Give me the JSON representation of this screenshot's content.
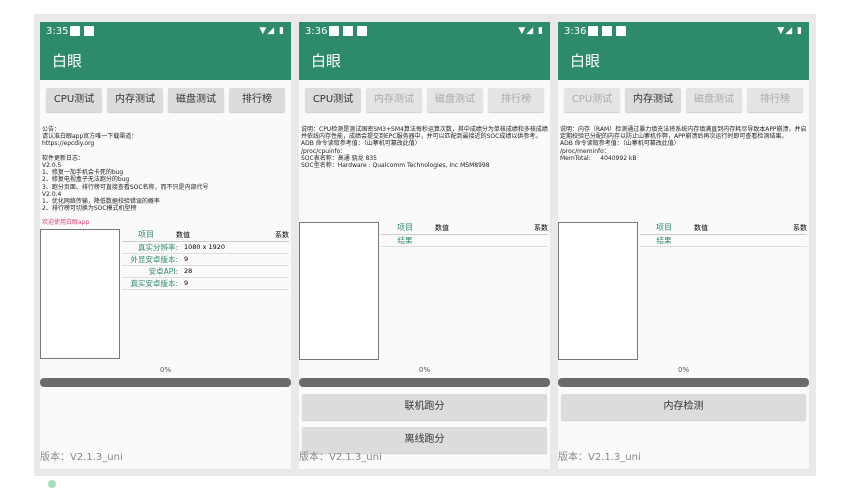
{
  "screens": [
    {
      "time": "3:35",
      "app_title": "白眼",
      "tabs": [
        "CPU测试",
        "内存测试",
        "磁盘测试",
        "排行榜"
      ],
      "notice": "公告：\n请认准白眼app官方唯一下载渠道：\nhttps://epcdiy.org\n\n软件更新日志：\nV2.0.5\n1、修复一加手机会卡死的bug\n2、修复电视盒子无法跑分的bug\n3、跑分页面、排行榜可直接查看SOC名称，而不只是内部代号\nV2.0.4\n1、优化网络传输，降低数据校验错误的概率\n2、排行榜可切换为SOC模式机型榜",
      "welcome": "欢迎使用白眼app",
      "table": {
        "headers": [
          "项目",
          "数值",
          "系数"
        ],
        "rows": [
          {
            "key": "真实分辨率:",
            "value": "1080 x 1920"
          },
          {
            "key": "外显安卓版本:",
            "value": "9"
          },
          {
            "key": "安卓API:",
            "value": "28"
          },
          {
            "key": "真实安卓版本:",
            "value": "9"
          }
        ]
      },
      "progress_text": "0%",
      "version": "版本：V2.1.3_uni"
    },
    {
      "time": "3:36",
      "app_title": "白眼",
      "tabs": [
        "CPU测试",
        "内存测试",
        "磁盘测试",
        "排行榜"
      ],
      "description": "说明：CPU检测是测试国密SM3+SM4算法每秒运算次数，其中成绩分为单核成绩和多核成绩并依线内存性能，成绩会提交到EPC服务器中，并可以匹配到最接近的SOC成绩以供参考。\nADB 命令读取参考值：（山寨机可篡改此值）\n/proc/cpuinfo：\nSOC表名称：高通 骁龙 835\nSOC型名称：Hardware : Qualcomm Technologies, Inc MSM8998",
      "table": {
        "headers": [
          "项目",
          "数值",
          "系数"
        ],
        "rows": [
          {
            "key": "结果",
            "value": ""
          }
        ]
      },
      "progress_text": "0%",
      "buttons": [
        "联机跑分",
        "离线跑分"
      ],
      "version": "版本：V2.1.3_uni"
    },
    {
      "time": "3:36",
      "app_title": "白眼",
      "tabs": [
        "CPU测试",
        "内存测试",
        "磁盘测试",
        "排行榜"
      ],
      "description": "说明：内存（RAM）检测通过暴力填充法将系统内存填满直到内存耗尽导致本APP崩溃，并启定期校验已分配的内存以防止山寨机作弊，APP崩溃后再次运行时即可查看检测结果。\nADB 命令读取参考值：（山寨机可篡改此值）\n/proc/meminfo：\nMemTotal:     4040992 kB",
      "table": {
        "headers": [
          "项目",
          "数值",
          "系数"
        ],
        "rows": [
          {
            "key": "结果",
            "value": ""
          }
        ]
      },
      "progress_text": "0%",
      "buttons": [
        "内存检测"
      ],
      "version": "版本：V2.1.3_uni"
    }
  ],
  "status_right": "▼◢ ▮",
  "colors": {
    "primary": "#2e8a6d",
    "welcome": "#e0457b"
  }
}
